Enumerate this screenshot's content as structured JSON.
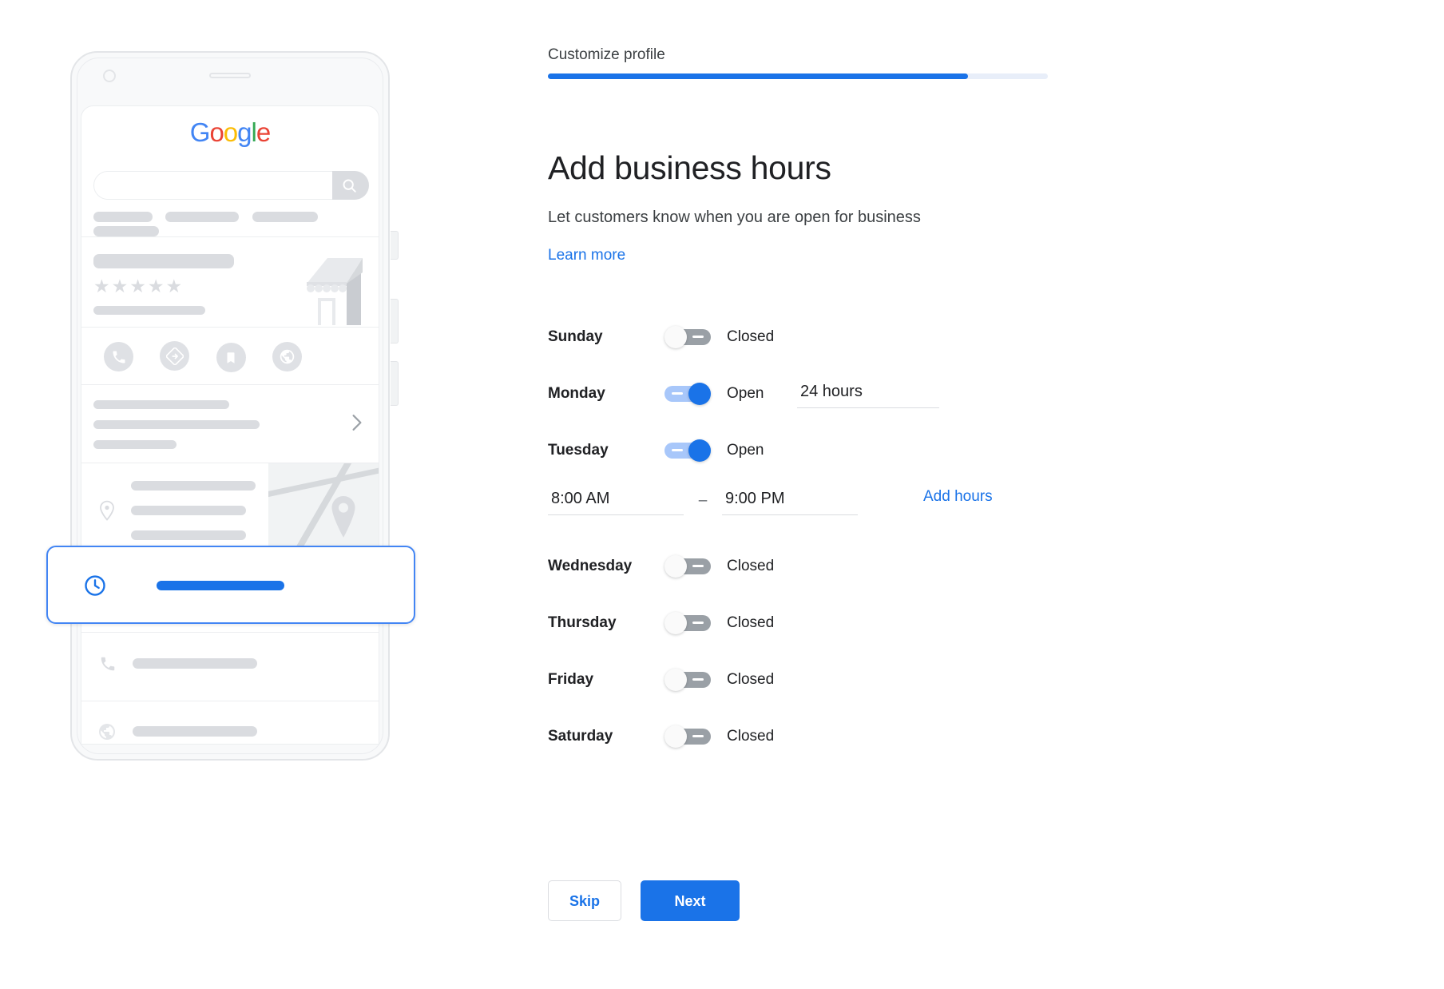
{
  "step": {
    "label": "Customize profile",
    "progress_percent": 84
  },
  "heading": {
    "title": "Add business hours",
    "subtitle": "Let customers know when you are open for business",
    "learn_more": "Learn more"
  },
  "hours": {
    "rows": [
      {
        "day": "Sunday",
        "state": "Closed",
        "open": false
      },
      {
        "day": "Monday",
        "state": "Open",
        "open": true,
        "value": "24 hours"
      },
      {
        "day": "Tuesday",
        "state": "Open",
        "open": true,
        "open_time": "8:00 AM",
        "separator": "–",
        "close_time": "9:00 PM",
        "add_hours": "Add hours"
      },
      {
        "day": "Wednesday",
        "state": "Closed",
        "open": false
      },
      {
        "day": "Thursday",
        "state": "Closed",
        "open": false
      },
      {
        "day": "Friday",
        "state": "Closed",
        "open": false
      },
      {
        "day": "Saturday",
        "state": "Closed",
        "open": false
      }
    ]
  },
  "actions": {
    "skip": "Skip",
    "next": "Next"
  },
  "preview": {
    "logo_letters": [
      "G",
      "o",
      "o",
      "g",
      "l",
      "e"
    ],
    "icons": {
      "search": "search-icon",
      "call": "phone-icon",
      "directions": "directions-icon",
      "save": "bookmark-icon",
      "website": "globe-icon",
      "place": "map-pin-icon",
      "hours": "clock-icon",
      "chevron": "chevron-right-icon"
    }
  },
  "colors": {
    "accent": "#1A73E8",
    "track_on": "#A8C7FA",
    "track_off": "#9AA0A6",
    "placeholder_gray": "#DADCE0",
    "progress_bg": "#E8EEF9"
  }
}
